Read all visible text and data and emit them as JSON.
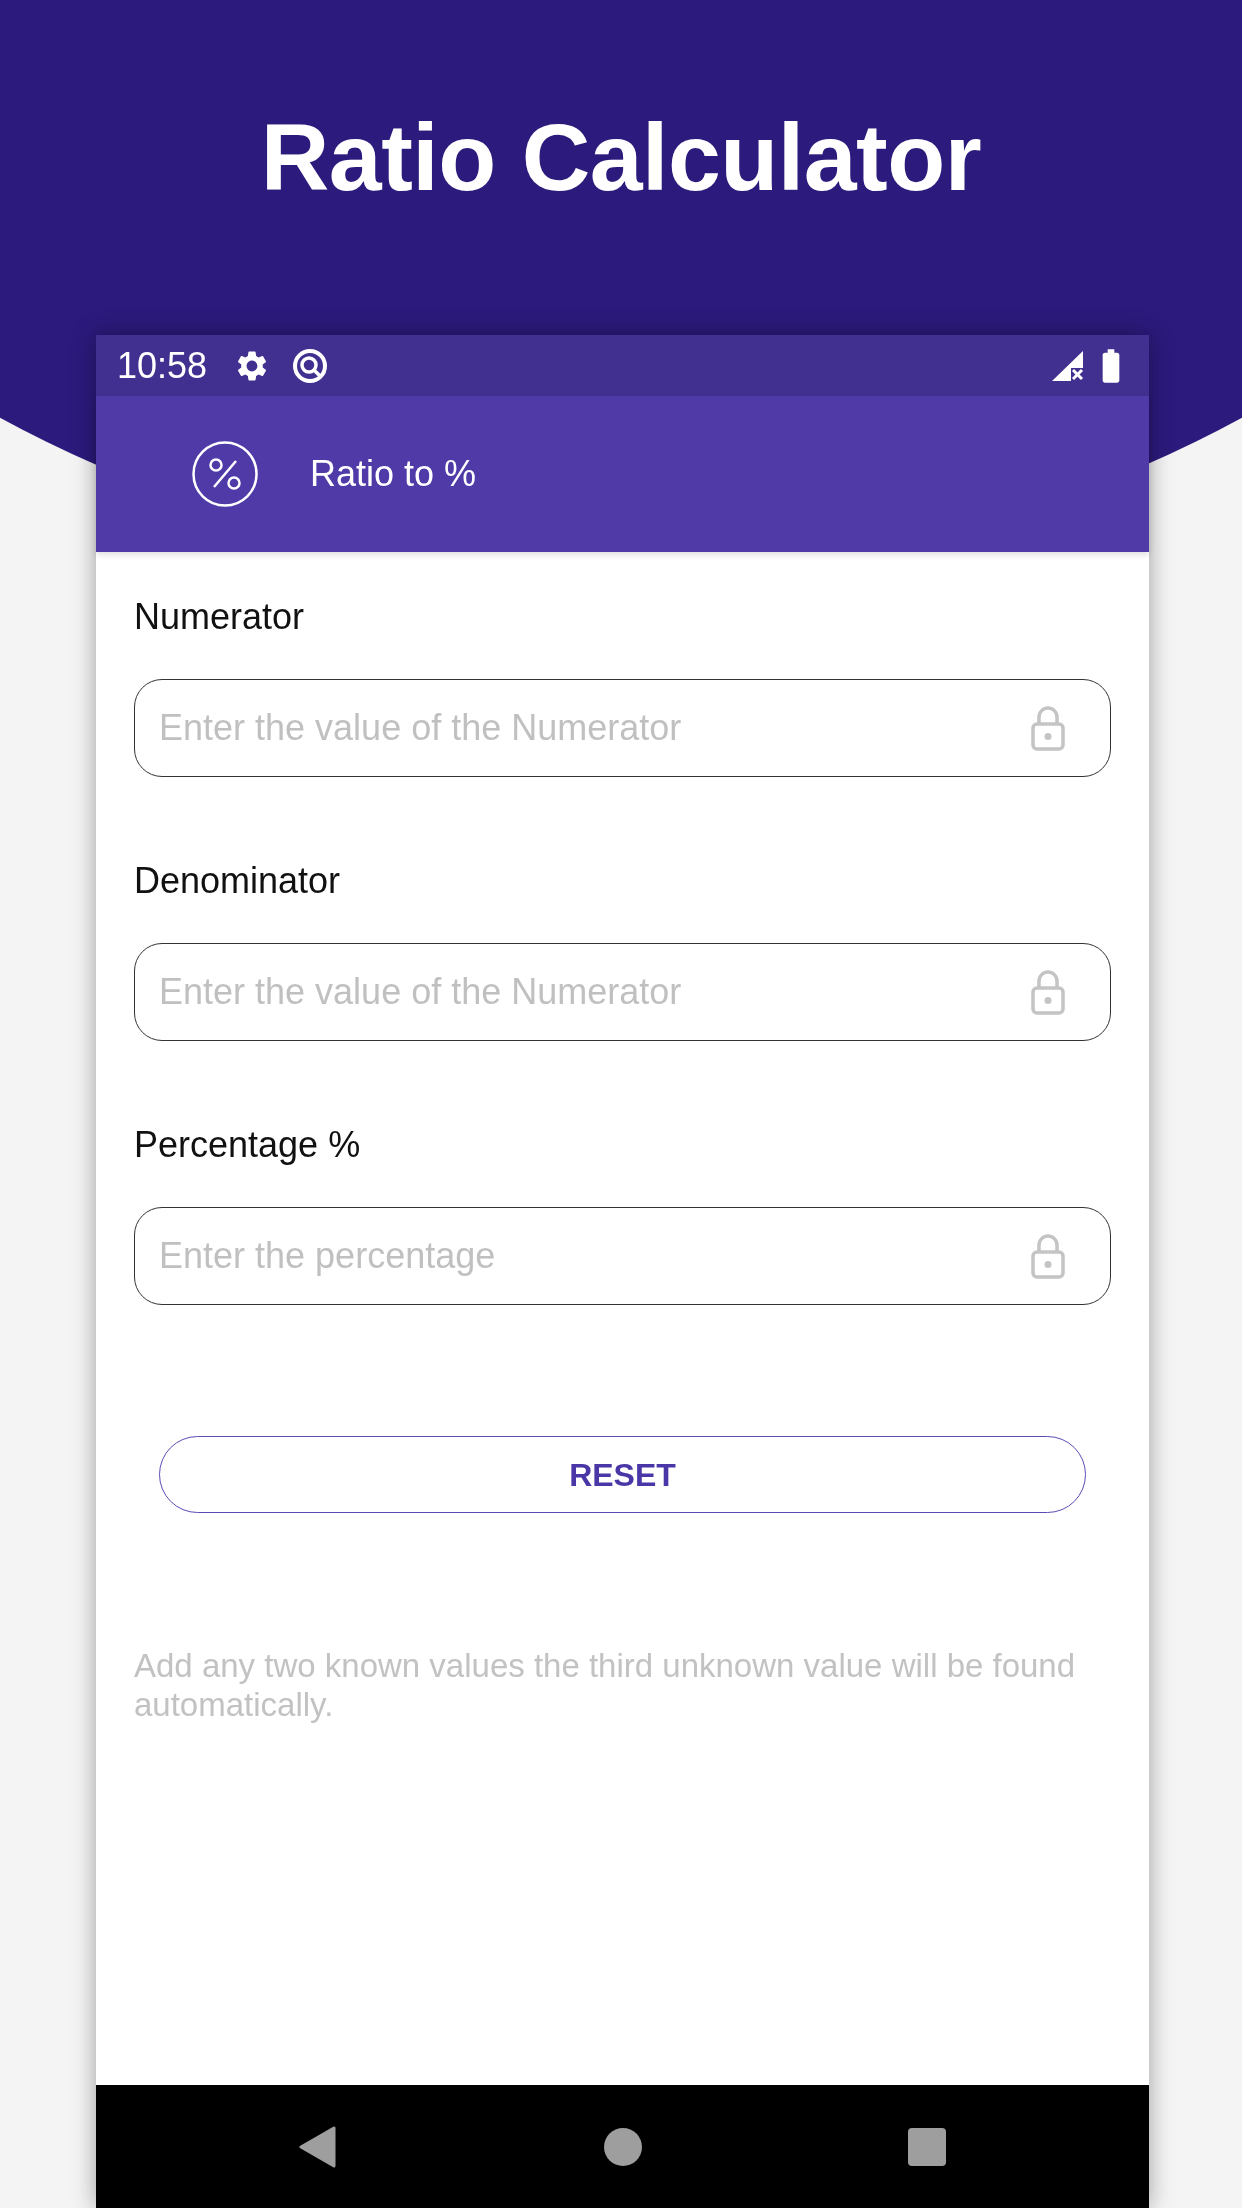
{
  "header": {
    "title": "Ratio Calculator"
  },
  "status_bar": {
    "time": "10:58"
  },
  "app_bar": {
    "title": "Ratio to %"
  },
  "fields": [
    {
      "label": "Numerator",
      "placeholder": "Enter the value of the Numerator"
    },
    {
      "label": "Denominator",
      "placeholder": "Enter the value of the Numerator"
    },
    {
      "label": "Percentage %",
      "placeholder": "Enter the percentage"
    }
  ],
  "reset_button": {
    "label": "RESET"
  },
  "hint": "Add any two known values the third unknown value will be found automatically."
}
